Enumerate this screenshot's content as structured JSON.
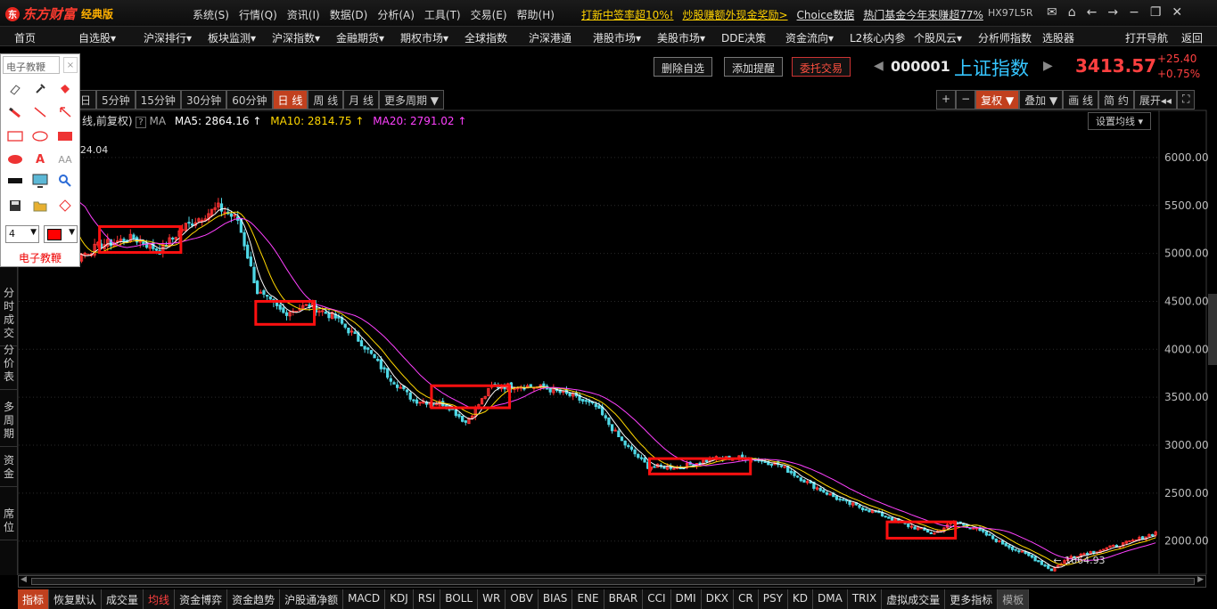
{
  "app": {
    "brand": "东方财富",
    "edition": "经典版",
    "account": "HX97L5R"
  },
  "sysmenu": [
    "系统(S)",
    "行情(Q)",
    "资讯(I)",
    "数据(D)",
    "分析(A)",
    "工具(T)",
    "交易(E)",
    "帮助(H)"
  ],
  "promos": [
    {
      "text": "打新中签率超10%!",
      "color": "#ffd200"
    },
    {
      "text": "炒股赚额外现金奖励>",
      "color": "#ffd200"
    },
    {
      "text": "Choice数据",
      "color": "#e0e0e0"
    },
    {
      "text": "热门基金今年来赚超77%",
      "color": "#e0e0e0"
    }
  ],
  "nav": [
    "首页",
    "自选股",
    "沪深排行",
    "板块监测",
    "沪深指数",
    "金融期货",
    "期权市场",
    "全球指数",
    "沪深港通",
    "港股市场",
    "美股市场",
    "DDE决策",
    "资金流向",
    "L2核心内参",
    "个股风云",
    "分析师指数",
    "选股器",
    "打开导航",
    "返回"
  ],
  "actions": {
    "del": "删除自选",
    "alert": "添加提醒",
    "trade": "委托交易"
  },
  "quote": {
    "code": "000001",
    "name": "上证指数",
    "price": "3413.57",
    "change": "+25.40",
    "pct": "+0.75%"
  },
  "tools": {
    "title": "电子教鞭",
    "close": "×",
    "linewidth": "4",
    "footer": "电子教鞭"
  },
  "periods": [
    "日",
    "5分钟",
    "15分钟",
    "30分钟",
    "60分钟",
    "日 线",
    "周 线",
    "月 线",
    "更多周期 ▼"
  ],
  "rightbar": [
    "+",
    "−",
    "复权 ▼",
    "叠加 ▼",
    "画 线",
    "简 约",
    "展开◂◂",
    "⛶"
  ],
  "ma": {
    "prefix": "日线,前复权)",
    "icon": "?",
    "label": "MA",
    "ma5": "MA5: 2864.16 ↑",
    "ma10": "MA10: 2814.75 ↑",
    "ma20": "MA20: 2791.02 ↑",
    "setbtn": "设置均线 ▾"
  },
  "side_tabs": [
    "分时成交",
    "分价表",
    "多周期",
    "资金",
    "席位"
  ],
  "bottom_tabs": [
    "指标",
    "恢复默认",
    "成交量",
    "均线",
    "资金博弈",
    "资金趋势",
    "沪股通净额",
    "MACD",
    "KDJ",
    "RSI",
    "BOLL",
    "WR",
    "OBV",
    "BIAS",
    "ENE",
    "BRAR",
    "CCI",
    "DMI",
    "DKX",
    "CR",
    "PSY",
    "KD",
    "DMA",
    "TRIX",
    "虚拟成交量",
    "更多指标",
    "模板"
  ],
  "colors": {
    "up": "#ff3232",
    "down": "#4fd8e6",
    "ma5": "#ffffff",
    "ma10": "#ffd700",
    "ma20": "#ff40ff",
    "box": "#ff1010",
    "grid": "#2a2a2a"
  },
  "chart_data": {
    "type": "candlestick",
    "title": "上证指数",
    "y_ticks": [
      "6000.00",
      "5500.00",
      "5000.00",
      "4500.00",
      "4000.00",
      "3500.00",
      "3000.00",
      "2500.00",
      "2000.00"
    ],
    "ylim": [
      1700,
      6250
    ],
    "labels": {
      "high": "24.04",
      "low": "1664.93"
    },
    "path": [
      [
        0,
        6124
      ],
      [
        6,
        5900
      ],
      [
        11,
        5250
      ],
      [
        16,
        4950
      ],
      [
        24,
        5090
      ],
      [
        34,
        5160
      ],
      [
        42,
        5030
      ],
      [
        50,
        5290
      ],
      [
        60,
        5480
      ],
      [
        66,
        5350
      ],
      [
        72,
        4600
      ],
      [
        80,
        4380
      ],
      [
        88,
        4460
      ],
      [
        96,
        4330
      ],
      [
        104,
        4070
      ],
      [
        112,
        3730
      ],
      [
        120,
        3470
      ],
      [
        130,
        3430
      ],
      [
        136,
        3240
      ],
      [
        144,
        3610
      ],
      [
        152,
        3620
      ],
      [
        160,
        3600
      ],
      [
        168,
        3520
      ],
      [
        176,
        3400
      ],
      [
        184,
        3040
      ],
      [
        192,
        2780
      ],
      [
        202,
        2770
      ],
      [
        212,
        2860
      ],
      [
        222,
        2870
      ],
      [
        232,
        2800
      ],
      [
        242,
        2590
      ],
      [
        252,
        2410
      ],
      [
        262,
        2300
      ],
      [
        272,
        2160
      ],
      [
        280,
        2080
      ],
      [
        286,
        2200
      ],
      [
        292,
        2140
      ],
      [
        300,
        1990
      ],
      [
        310,
        1830
      ],
      [
        316,
        1700
      ],
      [
        322,
        1840
      ],
      [
        330,
        1900
      ],
      [
        336,
        1950
      ],
      [
        342,
        2010
      ],
      [
        348,
        2090
      ]
    ],
    "consolidation_boxes": [
      [
        5280,
        5010
      ],
      [
        4500,
        4260
      ],
      [
        3620,
        3390
      ],
      [
        2860,
        2700
      ],
      [
        2200,
        2030
      ]
    ]
  }
}
